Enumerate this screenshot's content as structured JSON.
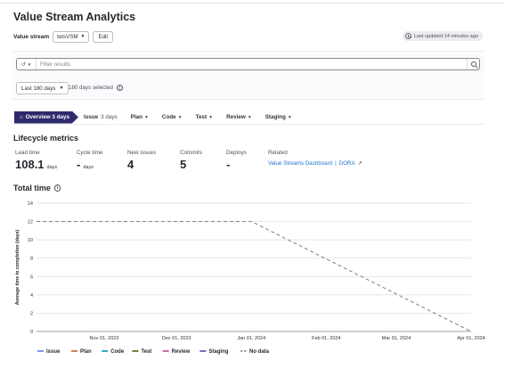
{
  "page": {
    "title": "Value Stream Analytics"
  },
  "value_stream": {
    "label": "Value stream",
    "selected": "tetsVSM",
    "edit_label": "Edit"
  },
  "last_updated": "Last updated 14 minutes ago",
  "filter": {
    "placeholder": "Filter results"
  },
  "date_range": {
    "selected": "Last 180 days",
    "days_selected": "180 days selected"
  },
  "stages": {
    "overview": "Overview 3 days",
    "items": [
      {
        "name": "Issue",
        "sub": "3 days",
        "chevron": false
      },
      {
        "name": "Plan",
        "sub": "",
        "chevron": true
      },
      {
        "name": "Code",
        "sub": "",
        "chevron": true
      },
      {
        "name": "Test",
        "sub": "",
        "chevron": true
      },
      {
        "name": "Review",
        "sub": "",
        "chevron": true
      },
      {
        "name": "Staging",
        "sub": "",
        "chevron": true
      }
    ]
  },
  "lifecycle": {
    "title": "Lifecycle metrics",
    "lead_time": {
      "label": "Lead time",
      "value": "108.1",
      "unit": "days"
    },
    "cycle_time": {
      "label": "Cycle time",
      "value": "-",
      "unit": "days"
    },
    "new_issues": {
      "label": "New issues",
      "value": "4"
    },
    "commits": {
      "label": "Commits",
      "value": "5"
    },
    "deploys": {
      "label": "Deploys",
      "value": "-"
    },
    "related": {
      "label": "Related",
      "link1": "Value Streams Dashboard",
      "separator": "|",
      "link2": "DORA"
    }
  },
  "total_time": {
    "title": "Total time"
  },
  "chart_data": {
    "type": "line",
    "ylabel": "Average time to completion (days)",
    "ylim": [
      0,
      14
    ],
    "yticks": [
      "0",
      "2",
      "4",
      "6",
      "8",
      "10",
      "12",
      "14"
    ],
    "xticks": [
      "Nov 01, 2023",
      "Dec 01, 2023",
      "Jan 01, 2024",
      "Feb 01, 2024",
      "Mar 01, 2024",
      "Apr 01, 2024"
    ],
    "xrange": [
      "2023-10-04",
      "2024-04-01"
    ],
    "grid": true,
    "legend_position": "bottom-left",
    "series": [
      {
        "name": "Issue",
        "color": "#617ae2",
        "values": []
      },
      {
        "name": "Plan",
        "color": "#c95d2e",
        "values": []
      },
      {
        "name": "Code",
        "color": "#0094b6",
        "values": []
      },
      {
        "name": "Test",
        "color": "#5f5a00",
        "values": []
      },
      {
        "name": "Review",
        "color": "#bd4b91",
        "values": []
      },
      {
        "name": "Staging",
        "color": "#4e4ac8",
        "values": []
      },
      {
        "name": "No data",
        "color": "#89888d",
        "dashed": true,
        "values": [
          {
            "x": "2023-10-04",
            "y": 12
          },
          {
            "x": "2024-01-01",
            "y": 12
          },
          {
            "x": "2024-04-01",
            "y": 0
          }
        ]
      }
    ]
  }
}
